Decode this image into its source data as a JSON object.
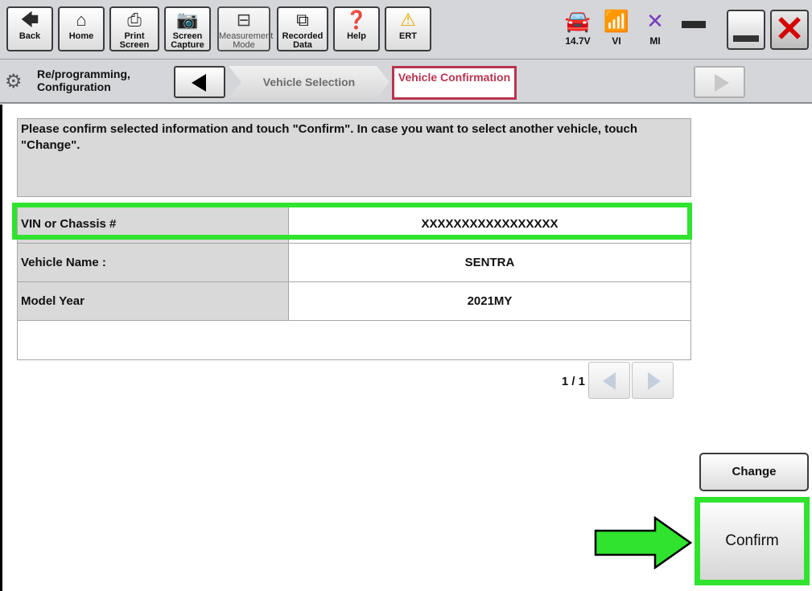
{
  "toolbar": {
    "buttons": [
      {
        "label": "Back",
        "icon": "back-arrow-icon"
      },
      {
        "label": "Home",
        "icon": "home-icon"
      },
      {
        "label": "Print Screen",
        "icon": "printer-icon"
      },
      {
        "label": "Screen Capture",
        "icon": "camera-icon"
      },
      {
        "label": "Measurement Mode",
        "icon": "meter-icon"
      },
      {
        "label": "Recorded Data",
        "icon": "recorded-data-icon"
      },
      {
        "label": "Help",
        "icon": "help-icon"
      },
      {
        "label": "ERT",
        "icon": "warning-icon"
      }
    ],
    "status": {
      "battery": "14.7V",
      "vi": "VI",
      "mi": "MI"
    }
  },
  "breadcrumb": {
    "section": "Re/programming, Configuration",
    "step1": "Vehicle Selection",
    "step2": "Vehicle Confirmation"
  },
  "main": {
    "instruction": "Please confirm selected information and touch \"Confirm\". In case you want to select another vehicle, touch \"Change\".",
    "rows": [
      {
        "key": "VIN or Chassis #",
        "value": "XXXXXXXXXXXXXXXXX"
      },
      {
        "key": "Vehicle Name :",
        "value": "SENTRA"
      },
      {
        "key": "Model Year",
        "value": "2021MY"
      },
      {
        "key": "",
        "value": ""
      }
    ],
    "pager": "1 / 1",
    "change_label": "Change",
    "confirm_label": "Confirm"
  },
  "colors": {
    "highlight": "#2fe32f",
    "active_crumb": "#b8344f",
    "toolbar_bg": "#d4d6d9"
  }
}
